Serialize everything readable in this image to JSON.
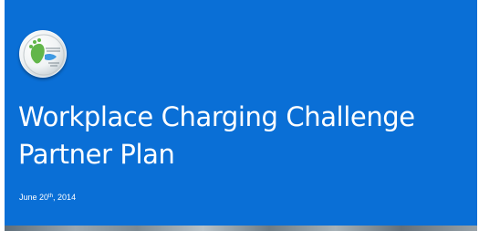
{
  "slide": {
    "title_line_1": "Workplace Charging Challenge",
    "title_line_2": "Partner Plan",
    "date_prefix": "June 20",
    "date_suffix": "th",
    "date_year": ", 2014"
  },
  "logo": {
    "icon": "green-footprint-seal-icon"
  },
  "colors": {
    "panel_background": "#0a6fd6",
    "text": "#ffffff",
    "logo_green": "#62b64a"
  }
}
